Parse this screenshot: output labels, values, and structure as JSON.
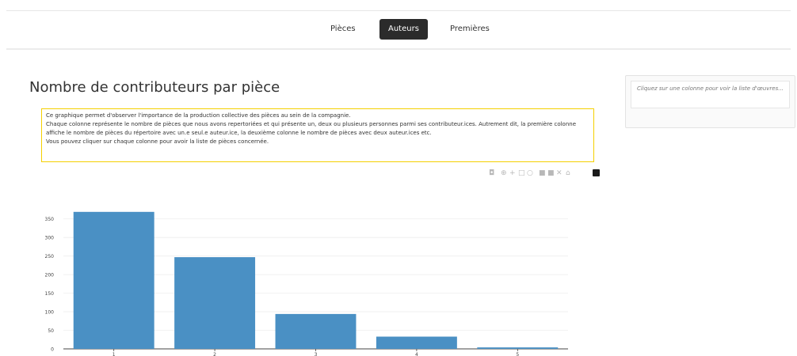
{
  "nav": {
    "items": [
      {
        "label": "Pièces",
        "active": false
      },
      {
        "label": "Auteurs",
        "active": true
      },
      {
        "label": "Premières",
        "active": false
      }
    ]
  },
  "title": "Nombre de contributeurs par pièce",
  "description": [
    "Ce graphique permet d'observer l'importance de la production collective des pièces au sein de la compagnie.",
    "Chaque colonne représente le nombre de pièces que nous avons repertoriées et qui présente un, deux ou plusieurs personnes parmi ses contributeur.ices. Autrement dit, la première colonne affiche le nombre de pièces du répertoire avec un.e seul.e auteur.ice, la deuxième colonne le nombre de pièces avec deux auteur.ices etc.",
    "Vous pouvez cliquer sur chaque colonne pour avoir la liste de pièces concernée."
  ],
  "side_panel": {
    "message": "Cliquez sur une colonne pour voir la liste d'œuvres..."
  },
  "modebar_icons": [
    "camera-icon",
    "zoom-icon",
    "pan-icon",
    "box-select-icon",
    "lasso-icon",
    "zoom-in-icon",
    "zoom-out-icon",
    "autoscale-icon",
    "reset-axes-icon",
    "plotly-logo-icon"
  ],
  "colors": {
    "bar": "#4a90c4",
    "accent_border": "#f5d000",
    "nav_active": "#2b2b2b"
  },
  "chart_data": {
    "type": "bar",
    "categories": [
      "1",
      "2",
      "3",
      "4",
      "5"
    ],
    "values": [
      369,
      247,
      94,
      33,
      4
    ],
    "ylim": [
      0,
      375
    ],
    "yticks": [
      0,
      50,
      100,
      150,
      200,
      250,
      300,
      350
    ],
    "grid": true
  }
}
